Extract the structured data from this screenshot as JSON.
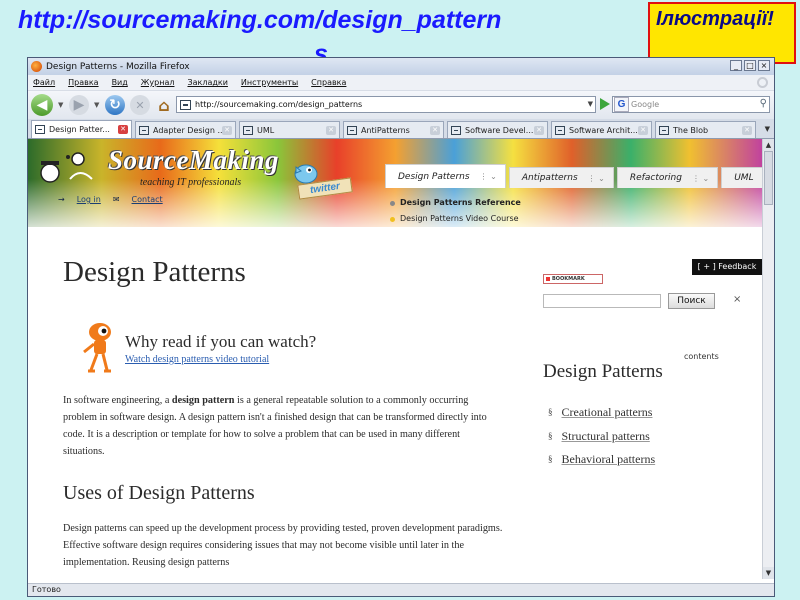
{
  "slide": {
    "title_line1": "http://sourcemaking.com/design_pattern",
    "title_line2": "s",
    "corner_label": "Ілюстрації!"
  },
  "browser": {
    "window_title": "Design Patterns - Mozilla Firefox",
    "menu": [
      "Файл",
      "Правка",
      "Вид",
      "Журнал",
      "Закладки",
      "Инструменты",
      "Справка"
    ],
    "url": "http://sourcemaking.com/design_patterns",
    "search_placeholder": "Google",
    "tabs": [
      {
        "label": "Design Patter...",
        "active": true
      },
      {
        "label": "Adapter Design ...",
        "active": false
      },
      {
        "label": "UML",
        "active": false
      },
      {
        "label": "AntiPatterns",
        "active": false
      },
      {
        "label": "Software Devel...",
        "active": false
      },
      {
        "label": "Software Archit...",
        "active": false
      },
      {
        "label": "The Blob",
        "active": false
      }
    ],
    "status": "Готово"
  },
  "site": {
    "logo": "SourceMaking",
    "logo_sub": "teaching IT professionals",
    "twitter": "twitter",
    "login": "Log in",
    "contact": "Contact",
    "nav_tabs": [
      "Design Patterns",
      "Antipatterns",
      "Refactoring",
      "UML"
    ],
    "submenu": [
      "Design Patterns Reference",
      "Design Patterns Video Course"
    ],
    "feedback": "[ + ] Feedback",
    "bookmark": "BOOKMARK",
    "search_button": "Поиск",
    "close_glyph": "×"
  },
  "page": {
    "h1": "Design Patterns",
    "why_heading": "Why read if you can watch?",
    "watch_link": "Watch design patterns video tutorial",
    "p1_lead": "In software engineering, a ",
    "p1_bold": "design pattern",
    "p1_rest": " is a general repeatable solution to a commonly occurring problem in software design. A design pattern isn't a finished design that can be transformed directly into code. It is a description or template for how to solve a problem that can be used in many different situations.",
    "h2": "Uses of Design Patterns",
    "p2": "Design patterns can speed up the development process by providing tested, proven development paradigms. Effective software design requires considering issues that may not become visible until later in the implementation. Reusing design patterns"
  },
  "sidebar": {
    "contents_label": "contents",
    "heading": "Design Patterns",
    "items": [
      "Creational patterns",
      "Structural patterns",
      "Behavioral patterns"
    ]
  },
  "colors": {
    "slide_bg": "#ccf2f2",
    "title_blue": "#1a1aff",
    "label_yellow": "#ffe600",
    "label_border": "#e01010"
  },
  "icons": [
    "firefox-icon",
    "back-icon",
    "forward-icon",
    "reload-icon",
    "stop-icon",
    "home-icon",
    "go-icon",
    "google-icon",
    "search-icon",
    "login-icon",
    "mail-icon",
    "robot-icon"
  ]
}
